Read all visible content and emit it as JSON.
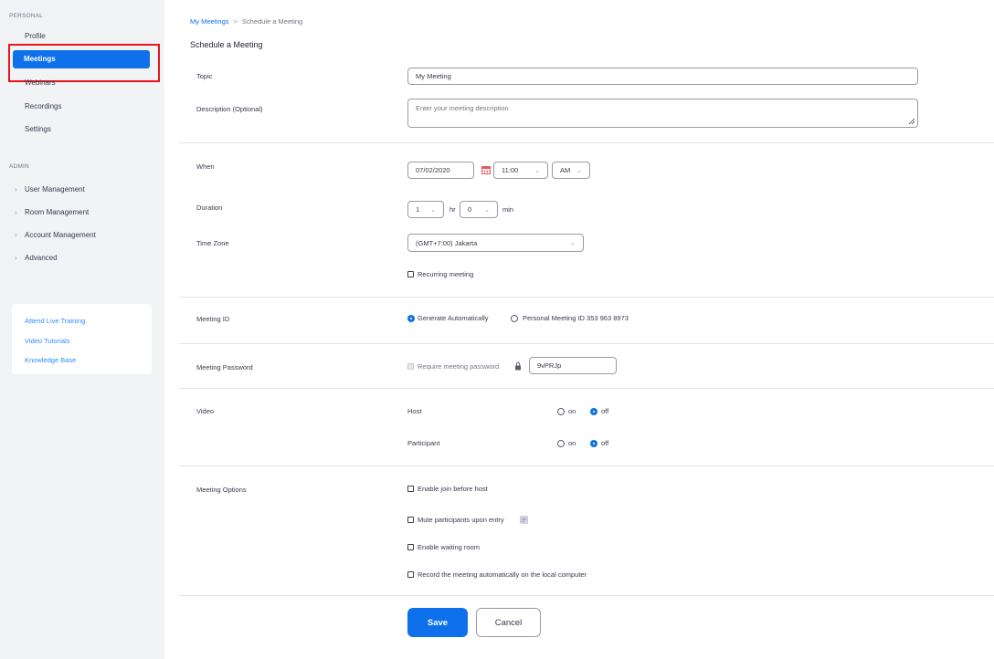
{
  "sidebar": {
    "personal_label": "PERSONAL",
    "personal_items": [
      "Profile",
      "Meetings",
      "Webinars",
      "Recordings",
      "Settings"
    ],
    "admin_label": "ADMIN",
    "admin_items": [
      "User Management",
      "Room Management",
      "Account Management",
      "Advanced"
    ],
    "links": [
      "Attend Live Training",
      "Video Tutorials",
      "Knowledge Base"
    ]
  },
  "breadcrumb": {
    "parent": "My Meetings",
    "separator": ">",
    "current": "Schedule a Meeting"
  },
  "page_title": "Schedule a Meeting",
  "form": {
    "topic": {
      "label": "Topic",
      "value": "My Meeting"
    },
    "description": {
      "label": "Description (Optional)",
      "placeholder": "Enter your meeting description"
    },
    "when": {
      "label": "When",
      "date": "07/02/2020",
      "time": "11:00",
      "ampm": "AM"
    },
    "duration": {
      "label": "Duration",
      "hours": "1",
      "hr_unit": "hr",
      "minutes": "0",
      "min_unit": "min"
    },
    "timezone": {
      "label": "Time Zone",
      "value": "(GMT+7:00) Jakarta"
    },
    "recurring": {
      "label": "Recurring meeting",
      "checked": false
    },
    "meeting_id": {
      "label": "Meeting ID",
      "option_auto": "Generate Automatically",
      "option_personal": "Personal Meeting ID 353 963 8973",
      "selected": "auto"
    },
    "password": {
      "label": "Meeting Password",
      "require_label": "Require meeting password",
      "value": "9vPRJp"
    },
    "video": {
      "label": "Video",
      "host_label": "Host",
      "participant_label": "Participant",
      "on_label": "on",
      "off_label": "off",
      "host": "off",
      "participant": "off"
    },
    "options": {
      "label": "Meeting Options",
      "items": [
        "Enable join before host",
        "Mute participants upon entry",
        "Enable waiting room",
        "Record the meeting automatically on the local computer"
      ]
    }
  },
  "buttons": {
    "save": "Save",
    "cancel": "Cancel"
  },
  "colors": {
    "accent": "#0e71eb",
    "highlight": "#e8141c",
    "sidebar_bg": "#f2f3f5"
  },
  "icons": {
    "calendar": "calendar-icon",
    "info": "info-icon",
    "lock": "lock-icon",
    "chevron": "chevron-right-icon"
  }
}
